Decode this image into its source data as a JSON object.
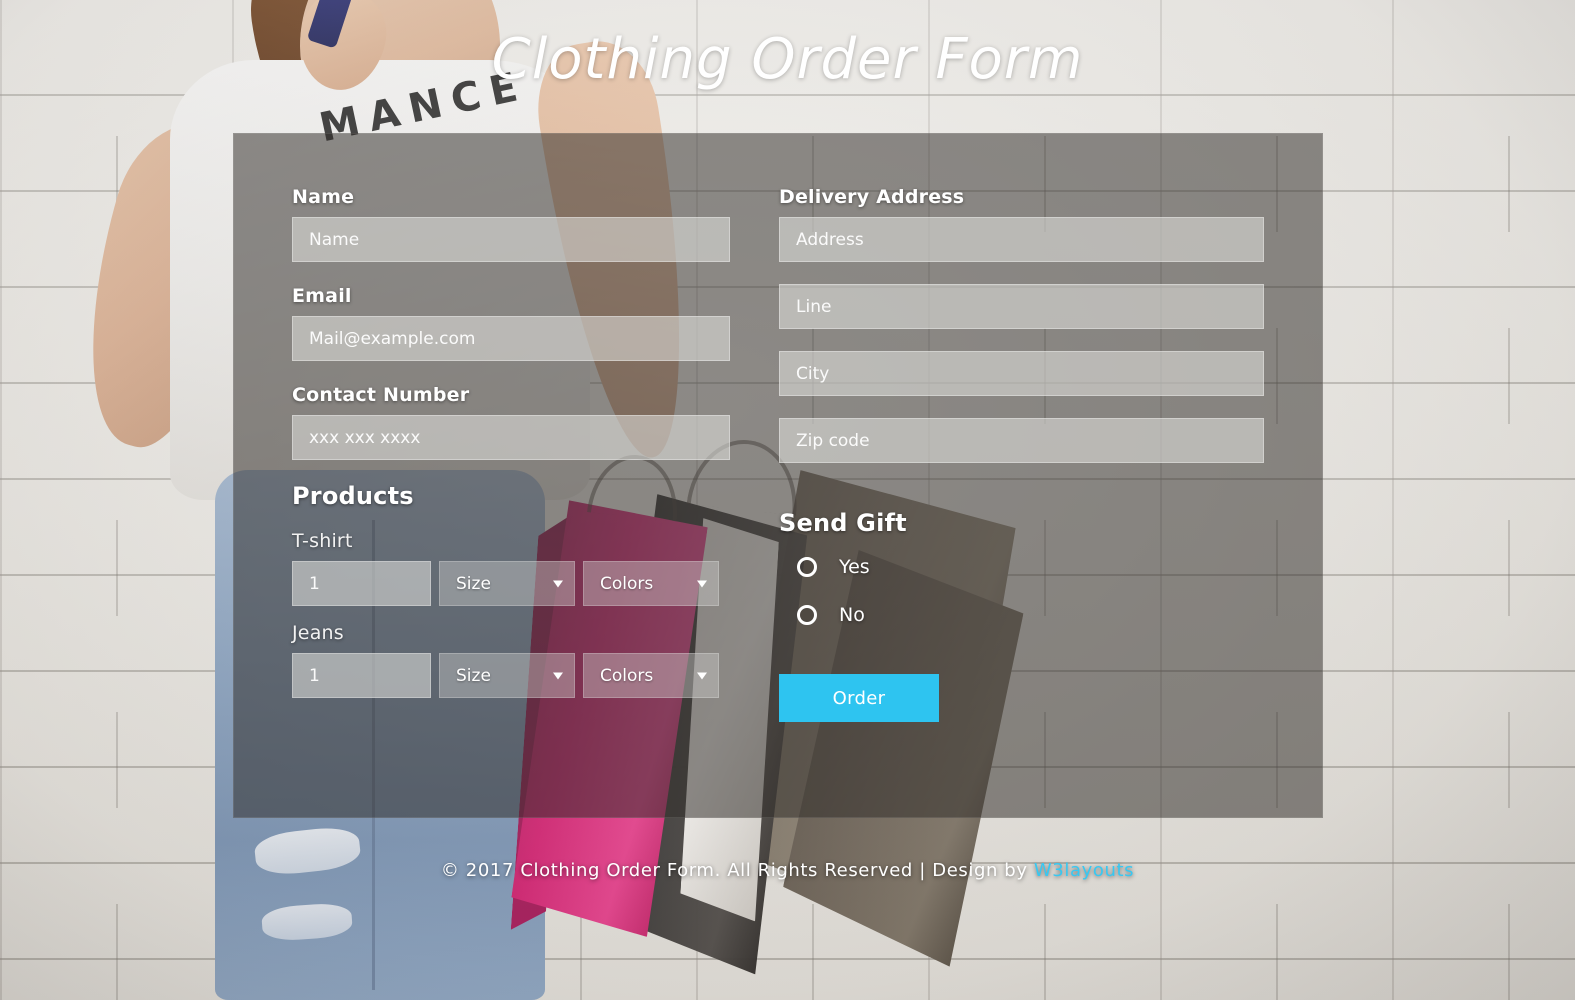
{
  "page": {
    "title": "Clothing Order Form",
    "accent_color": "#2ec4f0",
    "panel_color": "rgba(48,44,40,0.52)"
  },
  "form": {
    "left": {
      "name": {
        "label": "Name",
        "placeholder": "Name",
        "value": ""
      },
      "email": {
        "label": "Email",
        "placeholder": "Mail@example.com",
        "value": ""
      },
      "contact": {
        "label": "Contact Number",
        "placeholder": "xxx xxx xxxx",
        "value": ""
      },
      "products": {
        "heading": "Products",
        "items": [
          {
            "name": "T-shirt",
            "qty_placeholder": "1",
            "qty_value": "",
            "size_label": "Size",
            "size_options": [
              "Size"
            ],
            "colors_label": "Colors",
            "colors_options": [
              "Colors"
            ]
          },
          {
            "name": "Jeans",
            "qty_placeholder": "1",
            "qty_value": "",
            "size_label": "Size",
            "size_options": [
              "Size"
            ],
            "colors_label": "Colors",
            "colors_options": [
              "Colors"
            ]
          }
        ]
      }
    },
    "right": {
      "delivery": {
        "label": "Delivery Address",
        "fields": [
          {
            "placeholder": "Address",
            "value": ""
          },
          {
            "placeholder": "Line",
            "value": ""
          },
          {
            "placeholder": "City",
            "value": ""
          },
          {
            "placeholder": "Zip code",
            "value": ""
          }
        ]
      },
      "send_gift": {
        "heading": "Send Gift",
        "options": [
          {
            "label": "Yes",
            "selected": false
          },
          {
            "label": "No",
            "selected": false
          }
        ]
      },
      "submit_label": "Order"
    }
  },
  "background": {
    "shirt_text": "MANCE"
  },
  "footer": {
    "text": "© 2017 Clothing Order Form. All Rights Reserved | Design by ",
    "brand": "W3layouts"
  }
}
